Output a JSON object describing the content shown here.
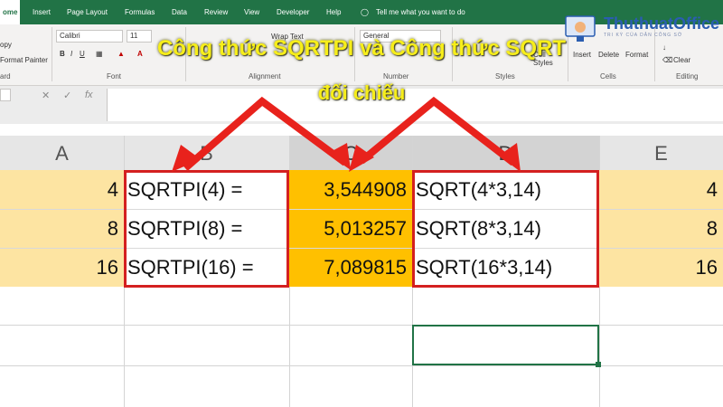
{
  "ribbon": {
    "tabs": [
      "ome",
      "Insert",
      "Page Layout",
      "Formulas",
      "Data",
      "Review",
      "View",
      "Developer",
      "Help"
    ],
    "tell_me": "Tell me what you want to do",
    "clipboard": {
      "copy": "opy",
      "format_painter": "Format Painter",
      "group": "ard"
    },
    "font": {
      "name": "Calibri",
      "size": "11",
      "group": "Font"
    },
    "alignment": {
      "wrap_text": "Wrap Text",
      "group": "Alignment"
    },
    "number": {
      "format": "General",
      "group": "Number"
    },
    "styles": {
      "cell_styles": "Cell Styles",
      "group": "Styles"
    },
    "cells": {
      "insert": "Insert",
      "delete": "Delete",
      "format": "Format",
      "group": "Cells"
    },
    "editing": {
      "clear": "Clear",
      "group": "Editing"
    }
  },
  "logo": {
    "name": "ThuthuatOffice",
    "tagline": "TRI KỲ CỦA DÂN CÔNG SỞ"
  },
  "overlay": {
    "title_line1": "Công thức SQRTPI và Công thức SQRT",
    "title_line2": "đối chiếu"
  },
  "columns": [
    "A",
    "B",
    "C",
    "D",
    "E"
  ],
  "rows": [
    {
      "a": "4",
      "b": "SQRTPI(4) =",
      "c": "3,544908",
      "d": "SQRT(4*3,14)",
      "e": "4"
    },
    {
      "a": "8",
      "b": "SQRTPI(8) =",
      "c": "5,013257",
      "d": "SQRT(8*3,14)",
      "e": "8"
    },
    {
      "a": "16",
      "b": "SQRTPI(16) =",
      "c": "7,089815",
      "d": "SQRT(16*3,14)",
      "e": "16"
    }
  ],
  "colors": {
    "excel_green": "#217346",
    "highlight_yellow": "#fde4a2",
    "highlight_orange": "#ffc000",
    "box_red": "#d42020",
    "title_yellow": "#f7ee1a"
  }
}
